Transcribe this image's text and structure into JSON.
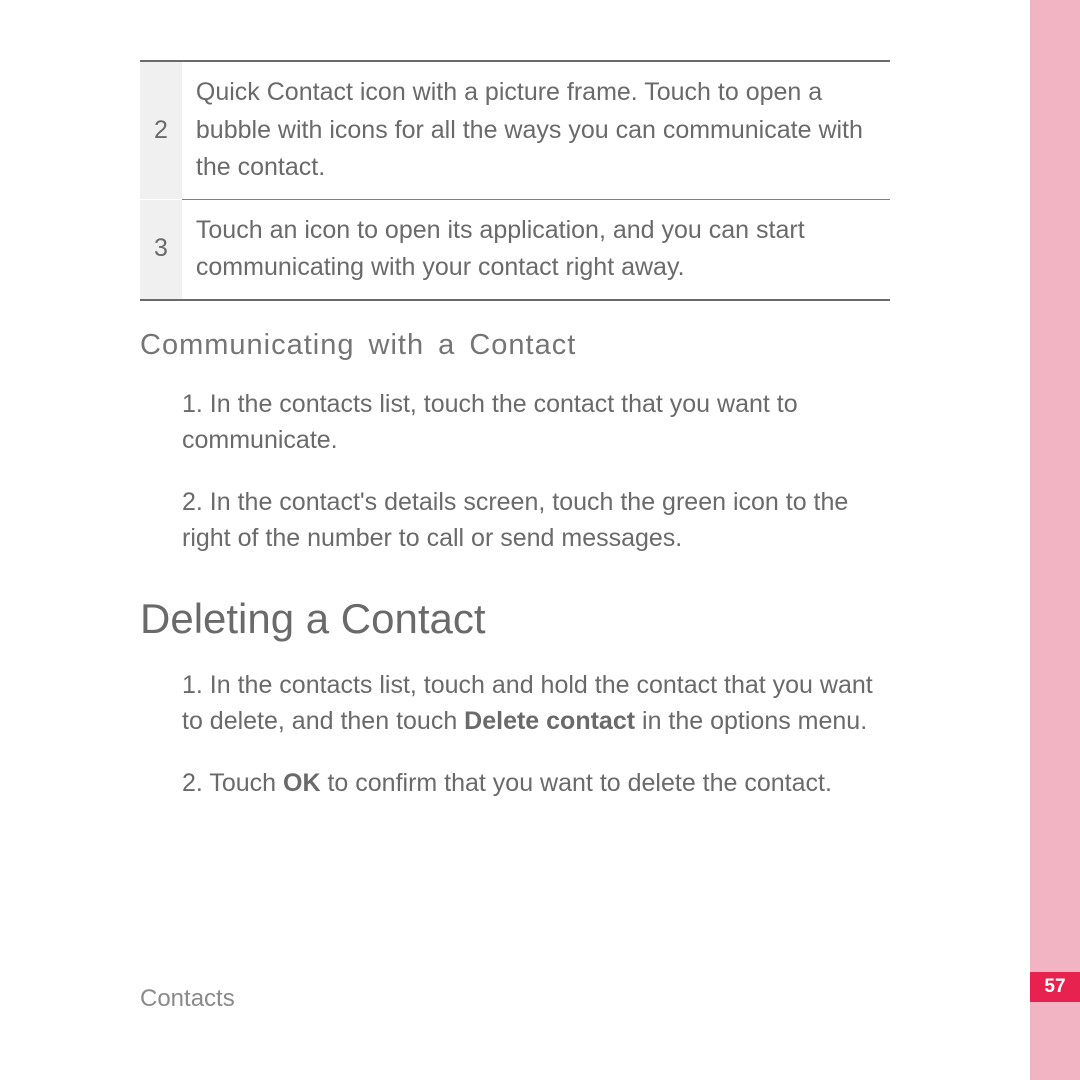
{
  "table": {
    "rows": [
      {
        "num": "2",
        "text": "Quick Contact icon with a picture frame. Touch to open a bubble with icons for all the ways you can communicate with the contact."
      },
      {
        "num": "3",
        "text": "Touch an icon to open its application, and you can start communicating with your contact right away."
      }
    ]
  },
  "subheading": "Communicating with a Contact",
  "comm_steps": {
    "step1_prefix": "1. ",
    "step1_text": "In the contacts list, touch the contact that you want to communicate.",
    "step2_prefix": "2. ",
    "step2_text": "In the contact's details screen, touch the green icon to the right of the number to call or send messages."
  },
  "heading": "Deleting a Contact",
  "delete_steps": {
    "step1_prefix": "1. ",
    "step1_before": "In the contacts list, touch and hold the contact that you want to delete, and then touch ",
    "step1_bold": "Delete contact",
    "step1_after": " in the options menu.",
    "step2_prefix": "2. ",
    "step2_before": "Touch ",
    "step2_bold": "OK",
    "step2_after": " to confirm that you want to delete the contact."
  },
  "footer": "Contacts",
  "page_number": "57"
}
